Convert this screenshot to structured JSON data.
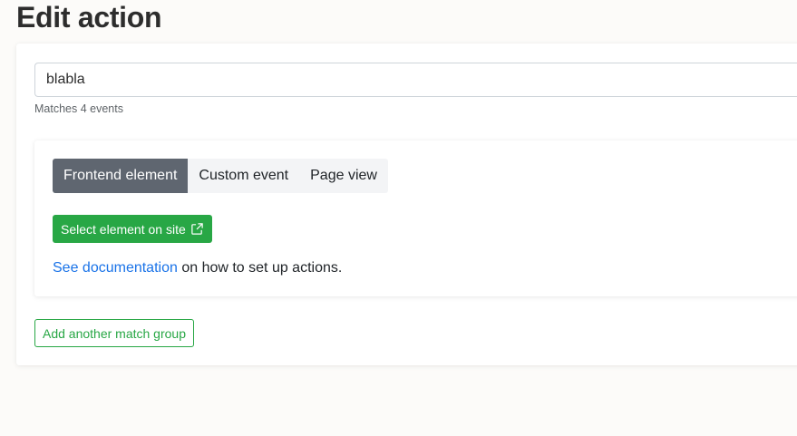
{
  "page": {
    "title": "Edit action"
  },
  "action": {
    "name_value": "blabla",
    "match_count_text": "Matches 4 events"
  },
  "match_group": {
    "tabs": [
      {
        "label": "Frontend element",
        "active": true
      },
      {
        "label": "Custom event",
        "active": false
      },
      {
        "label": "Page view",
        "active": false
      }
    ],
    "select_button_label": "Select element on site",
    "select_button_icon": "external-link-icon",
    "doc_link_text": "See documentation",
    "doc_suffix_text": " on how to set up actions."
  },
  "add_group_button_label": "Add another match group",
  "colors": {
    "primary_green": "#28a745",
    "active_tab": "#5f6670",
    "link_blue": "#1a73e8"
  }
}
